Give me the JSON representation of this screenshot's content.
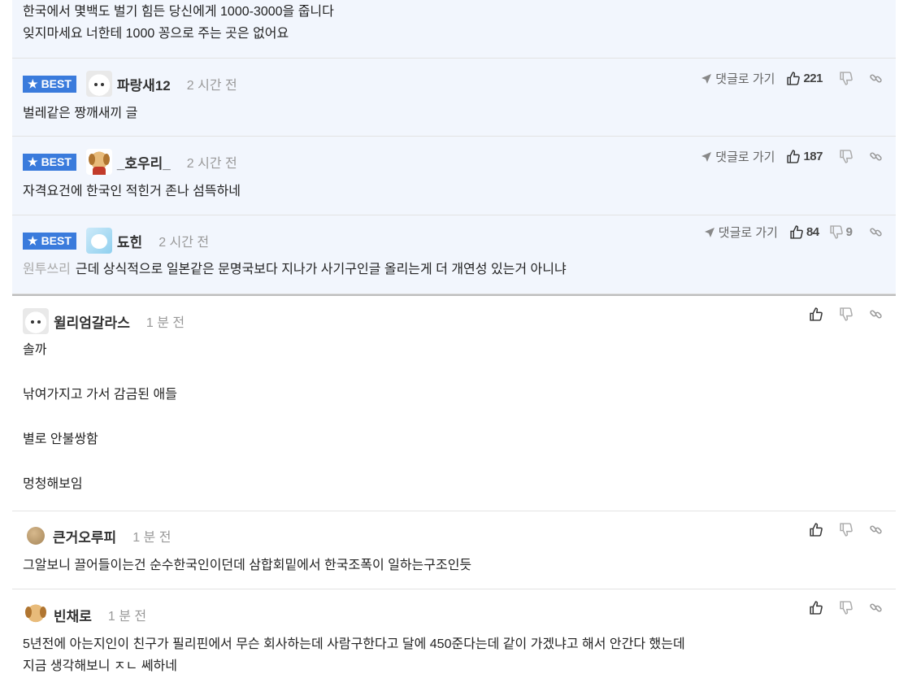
{
  "top_comment": {
    "lines": [
      "한국에서 몇백도 벌기 힘든 당신에게 1000-3000을 줍니다",
      "잊지마세요 너한테 1000 꽁으로 주는 곳은 없어요"
    ]
  },
  "best_badge_label": "BEST",
  "goto_label": "댓글로 가기",
  "best_comments": [
    {
      "nick": "파랑새12",
      "time": "2 시간 전",
      "text": "벌레같은 짱깨새끼 글",
      "likes": "221",
      "dislikes": ""
    },
    {
      "nick": "_호우리_",
      "time": "2 시간 전",
      "text": "자격요건에 한국인 적힌거 존나 섬뜩하네",
      "likes": "187",
      "dislikes": ""
    },
    {
      "nick": "됴힌",
      "time": "2 시간 전",
      "reply_to": "원투쓰리",
      "text": "근데 상식적으로 일본같은 문명국보다 지나가 사기구인글 올리는게 더 개연성 있는거 아니냐",
      "likes": "84",
      "dislikes": "9"
    }
  ],
  "comments": [
    {
      "nick": "윌리엄갈라스",
      "time": "1 분 전",
      "lines": [
        "솔까",
        "",
        "낚여가지고 가서 감금된 애들",
        "",
        "별로 안불쌍함",
        "",
        "멍청해보임"
      ]
    },
    {
      "nick": "큰거오루피",
      "time": "1 분 전",
      "lines": [
        "그알보니 끌어들이는건 순수한국인이던데 삼합회밑에서 한국조폭이 일하는구조인듯"
      ]
    },
    {
      "nick": "빈채로",
      "time": "1 분 전",
      "lines": [
        "5년전에 아는지인이 친구가 필리핀에서 무슨 회사하는데 사람구한다고 달에 450준다는데 같이 가겠냐고 해서 안간다 했는데",
        "지금 생각해보니 ㅈㄴ 쎄하네"
      ]
    }
  ],
  "colors": {
    "best_bg": "#f2f6fd",
    "badge": "#3a7bdc"
  }
}
